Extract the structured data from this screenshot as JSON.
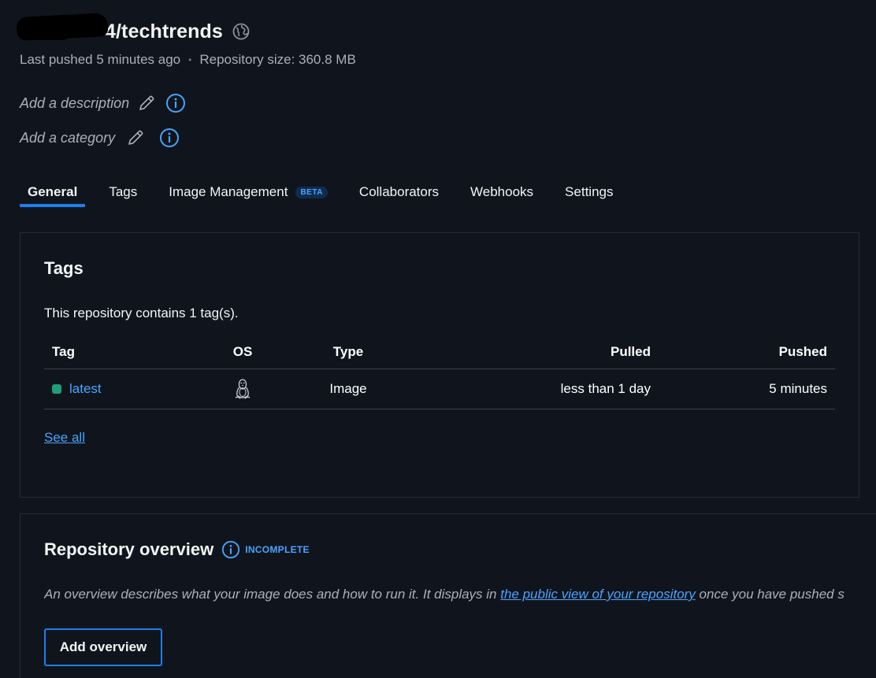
{
  "repo": {
    "name_suffix": "4/techtrends",
    "last_pushed": "Last pushed 5 minutes ago",
    "separator": "•",
    "size": "Repository size: 360.8 MB",
    "add_description": "Add a description",
    "add_category": "Add a category"
  },
  "tabs": [
    {
      "label": "General",
      "active": true
    },
    {
      "label": "Tags"
    },
    {
      "label": "Image Management",
      "badge": "BETA"
    },
    {
      "label": "Collaborators"
    },
    {
      "label": "Webhooks"
    },
    {
      "label": "Settings"
    }
  ],
  "tags_card": {
    "title": "Tags",
    "summary": "This repository contains 1 tag(s).",
    "columns": [
      "Tag",
      "OS",
      "Type",
      "Pulled",
      "Pushed"
    ],
    "rows": [
      {
        "tag": "latest",
        "os_icon": "linux-icon",
        "type": "Image",
        "pulled": "less than 1 day",
        "pushed": "5 minutes"
      }
    ],
    "see_all": "See all"
  },
  "overview_card": {
    "title": "Repository overview",
    "status": "INCOMPLETE",
    "desc_before": "An overview describes what your image does and how to run it. It displays in ",
    "desc_link": "the public view of your repository",
    "desc_after": " once you have pushed s",
    "button": "Add overview"
  },
  "colors": {
    "background": "#10151d",
    "accent": "#1d7ff0",
    "link": "#4aa3ff",
    "status_green": "#1f9e7a"
  }
}
